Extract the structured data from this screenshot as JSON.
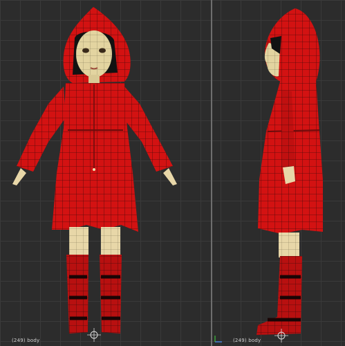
{
  "viewports": [
    {
      "name": "front",
      "status_label": "(249) body",
      "colors": {
        "grid": "#3a3a3a",
        "background": "#2c2c2c",
        "coat": "#d31212",
        "wire": "#4a0a0a",
        "skin": "#e8d7a8"
      }
    },
    {
      "name": "side",
      "status_label": "(249) body",
      "colors": {
        "grid": "#3a3a3a",
        "background": "#2c2c2c",
        "coat": "#d31212",
        "wire": "#4a0a0a",
        "skin": "#e8d7a8"
      }
    }
  ]
}
